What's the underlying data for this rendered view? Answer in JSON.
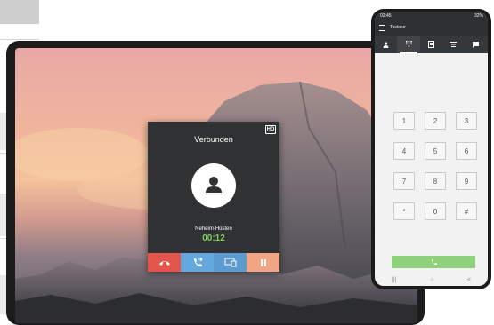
{
  "call_dialog": {
    "status": "Verbunden",
    "hd_badge": "HD",
    "caller_name": "Neheim-Hüsten",
    "duration": "00:12",
    "buttons": [
      {
        "name": "hangup",
        "color": "#e3554a"
      },
      {
        "name": "transfer",
        "color": "#63a9dd"
      },
      {
        "name": "screen-share",
        "color": "#5b9bcf"
      },
      {
        "name": "hold",
        "color": "#f1a585"
      }
    ]
  },
  "phone": {
    "status_time": "02:45",
    "status_right": "32%",
    "app_title": "Tastatur",
    "tabs": [
      "contacts",
      "keypad",
      "history",
      "voicemail",
      "chat"
    ],
    "active_tab": "keypad",
    "keys": [
      "1",
      "2",
      "3",
      "4",
      "5",
      "6",
      "7",
      "8",
      "9",
      "*",
      "0",
      "#"
    ],
    "call_button_color": "#8fd07a",
    "nav": [
      "|||",
      "○",
      "<"
    ]
  }
}
